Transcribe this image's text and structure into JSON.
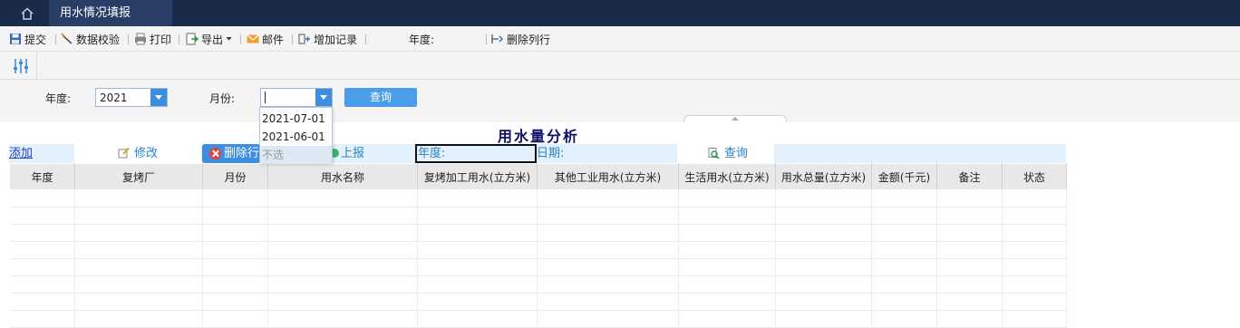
{
  "tabbar": {
    "tab_label": "用水情况填报"
  },
  "toolbar": {
    "submit": "提交",
    "validate": "数据校验",
    "print": "打印",
    "export": "导出",
    "mail": "邮件",
    "add_record": "增加记录",
    "year_label": "年度:",
    "delete_row": "删除列行"
  },
  "filters": {
    "year_label": "年度:",
    "year_value": "2021",
    "month_label": "月份:",
    "month_value": "",
    "query_button": "查询",
    "month_options": [
      "2021-07-01",
      "2021-06-01",
      "不选"
    ]
  },
  "report": {
    "title": "用水量分析",
    "actions": {
      "add": "添加",
      "edit": "修改",
      "delete": "删除行",
      "submit": "上报",
      "year": "年度:",
      "date": "日期:",
      "query": "查询"
    },
    "columns": [
      "年度",
      "复烤厂",
      "月份",
      "用水名称",
      "复烤加工用水(立方米)",
      "其他工业用水(立方米)",
      "生活用水(立方米)",
      "用水总量(立方米)",
      "金额(千元)",
      "备注",
      "状态"
    ]
  },
  "colors": {
    "topbar": "#1c2a4a",
    "accent": "#3d8ede",
    "title": "#10106a",
    "action_row": "#e2f1fb"
  }
}
